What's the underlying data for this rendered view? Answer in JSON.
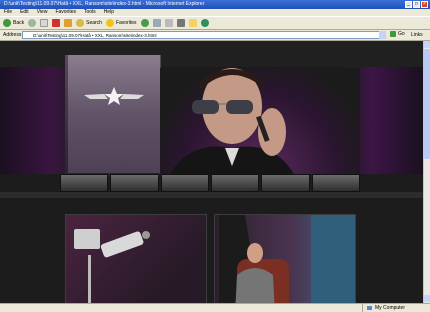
{
  "window": {
    "title": "D:\\unit\\Testing\\11.09.07\\Hatâ • XXL, Ransom\\site\\index-3.html - Microsoft Internet Explorer",
    "controls": [
      "_",
      "□",
      "×"
    ]
  },
  "menubar": {
    "items": [
      "File",
      "Edit",
      "View",
      "Favorites",
      "Tools",
      "Help"
    ]
  },
  "toolbar": {
    "back": "Back",
    "search": "Search",
    "favorites": "Favorites"
  },
  "addressbar": {
    "label": "Address",
    "url": "D:\\unit\\Testing\\11.09.07\\Hatâ • XXL, Ransom\\site\\index-3.html",
    "go": "Go",
    "links": "Links"
  },
  "page": {
    "header": {
      "logo": "star-wings-logo",
      "nav": [
        "",
        "",
        "",
        "",
        "",
        ""
      ]
    }
  },
  "statusbar": {
    "text": "",
    "zone": "My Computer"
  },
  "colors": {
    "title_bar": "#2456c8",
    "chrome": "#ece9d8",
    "page_bg": "#1c1c1c",
    "accent_purple": "#5d2a5e"
  }
}
